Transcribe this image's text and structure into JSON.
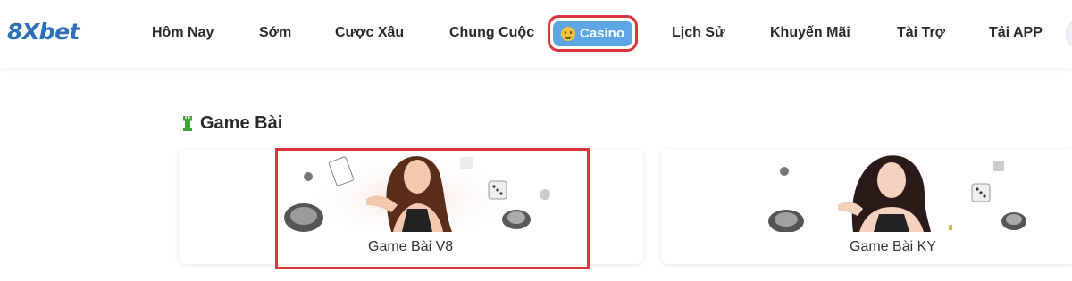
{
  "header": {
    "logo": "8Xbet",
    "nav": [
      {
        "label": "Hôm Nay"
      },
      {
        "label": "Sớm"
      },
      {
        "label": "Cược Xâu"
      },
      {
        "label": "Chung Cuộc"
      },
      {
        "label": "Casino",
        "active": true
      },
      {
        "label": "Lịch Sử"
      },
      {
        "label": "Khuyến Mãi"
      },
      {
        "label": "Tài Trợ"
      },
      {
        "label": "Tải APP"
      }
    ]
  },
  "section": {
    "title": "Game Bài",
    "cards": [
      {
        "label": "Game Bài V8",
        "highlighted": true
      },
      {
        "label": "Game Bài KY"
      }
    ]
  },
  "colors": {
    "accent": "#5ea5e6",
    "highlight_border": "#d9363e",
    "brand": "#2f6fba",
    "rook_green": "#3fa535"
  }
}
